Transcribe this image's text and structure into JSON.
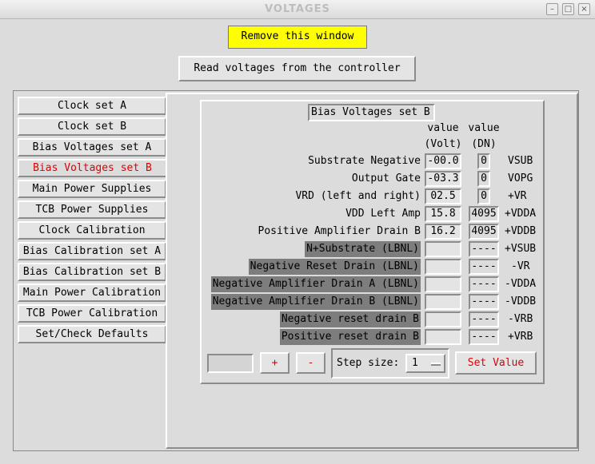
{
  "window": {
    "title": "VOLTAGES"
  },
  "controls": {
    "remove_label": "Remove this window",
    "read_label": "Read voltages from the controller"
  },
  "tabs": [
    {
      "label": "Clock set A"
    },
    {
      "label": "Clock set B"
    },
    {
      "label": "Bias Voltages set A"
    },
    {
      "label": "Bias Voltages set B",
      "active": true
    },
    {
      "label": "Main Power Supplies"
    },
    {
      "label": "TCB Power Supplies"
    },
    {
      "label": "Clock Calibration"
    },
    {
      "label": "Bias Calibration set A"
    },
    {
      "label": "Bias Calibration set B"
    },
    {
      "label": "Main Power Calibration"
    },
    {
      "label": "TCB Power Calibration"
    },
    {
      "label": "Set/Check Defaults"
    }
  ],
  "panel": {
    "title": "Bias Voltages set B",
    "headers": {
      "volt_line1": "value",
      "volt_line2": "(Volt)",
      "dn_line1": "value",
      "dn_line2": "(DN)"
    },
    "rows": [
      {
        "label": "Substrate Negative",
        "volt": "-00.0",
        "dn": "0",
        "code": "VSUB"
      },
      {
        "label": "Output Gate",
        "volt": "-03.3",
        "dn": "0",
        "code": "VOPG"
      },
      {
        "label": "VRD (left and right)",
        "volt": "02.5",
        "dn": "0",
        "code": "+VR"
      },
      {
        "label": "VDD Left Amp",
        "volt": "15.8",
        "dn": "4095",
        "code": "+VDDA"
      },
      {
        "label": "Positive Amplifier Drain B",
        "volt": "16.2",
        "dn": "4095",
        "code": "+VDDB"
      },
      {
        "label": "N+Substrate (LBNL)",
        "volt": "",
        "dn": "----",
        "code": "+VSUB"
      },
      {
        "label": "Negative Reset Drain (LBNL)",
        "volt": "",
        "dn": "----",
        "code": "-VR"
      },
      {
        "label": "Negative Amplifier Drain A (LBNL)",
        "volt": "",
        "dn": "----",
        "code": "-VDDA"
      },
      {
        "label": "Negative Amplifier Drain B (LBNL)",
        "volt": "",
        "dn": "----",
        "code": "-VDDB"
      },
      {
        "label": "Negative reset drain B",
        "volt": "",
        "dn": "----",
        "code": "-VRB"
      },
      {
        "label": "Positive reset drain B",
        "volt": "",
        "dn": "----",
        "code": "+VRB"
      }
    ],
    "plus_label": "+",
    "minus_label": "-",
    "step_label": "Step size:",
    "step_value": "1",
    "set_value_label": "Set Value"
  }
}
